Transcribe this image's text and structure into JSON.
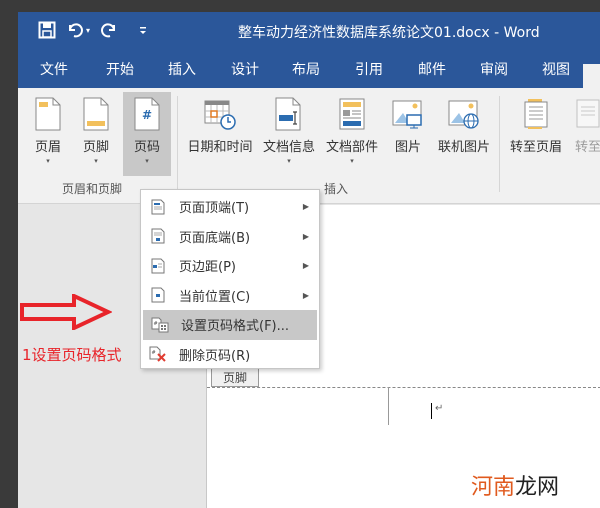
{
  "window": {
    "title": "整车动力经济性数据库系统论文01.docx - Word",
    "qat": [
      "save-icon",
      "undo-icon",
      "redo-icon",
      "customize-qat-icon"
    ]
  },
  "tabs": [
    {
      "label": "文件"
    },
    {
      "label": "开始"
    },
    {
      "label": "插入"
    },
    {
      "label": "设计"
    },
    {
      "label": "布局"
    },
    {
      "label": "引用"
    },
    {
      "label": "邮件"
    },
    {
      "label": "审阅"
    },
    {
      "label": "视图"
    }
  ],
  "ribbon": {
    "groups": [
      {
        "label": "页眉和页脚",
        "buttons": [
          {
            "label": "页眉",
            "icon": "header-icon",
            "dropdown": true
          },
          {
            "label": "页脚",
            "icon": "footer-icon",
            "dropdown": true
          },
          {
            "label": "页码",
            "icon": "page-number-icon",
            "dropdown": true,
            "active": true
          }
        ]
      },
      {
        "label": "插入",
        "buttons": [
          {
            "label": "日期和时间",
            "icon": "date-time-icon"
          },
          {
            "label": "文档信息",
            "icon": "document-info-icon",
            "dropdown": true
          },
          {
            "label": "文档部件",
            "icon": "quick-parts-icon",
            "dropdown": true
          },
          {
            "label": "图片",
            "icon": "picture-icon"
          },
          {
            "label": "联机图片",
            "icon": "online-picture-icon"
          }
        ]
      },
      {
        "label": "",
        "buttons": [
          {
            "label": "转至页眉",
            "icon": "goto-header-icon"
          },
          {
            "label": "转至",
            "icon": "goto-footer-icon",
            "disabled": true
          }
        ]
      }
    ],
    "dropdown_glyph": "▾"
  },
  "page_number_menu": {
    "items": [
      {
        "label": "页面顶端(T)",
        "submenu": true
      },
      {
        "label": "页面底端(B)",
        "submenu": true
      },
      {
        "label": "页边距(P)",
        "submenu": true
      },
      {
        "label": "当前位置(C)",
        "submenu": true
      },
      {
        "label": "设置页码格式(F)...",
        "submenu": false,
        "highlighted": true
      },
      {
        "label": "删除页码(R)",
        "submenu": false
      }
    ],
    "submenu_glyph": "▶"
  },
  "document": {
    "footer_tag": "页脚",
    "paragraph_mark": "↵"
  },
  "annotation": {
    "text": "1设置页码格式",
    "color": "#e8242a"
  },
  "watermark": {
    "part1": "河南",
    "part2": "龙网"
  },
  "colors": {
    "word_blue": "#2b579a",
    "ribbon_bg": "#f1f1f1",
    "menu_highlight": "#c8c8c8",
    "icon_yellow": "#f2c05c",
    "icon_blue": "#2b6cb0"
  }
}
